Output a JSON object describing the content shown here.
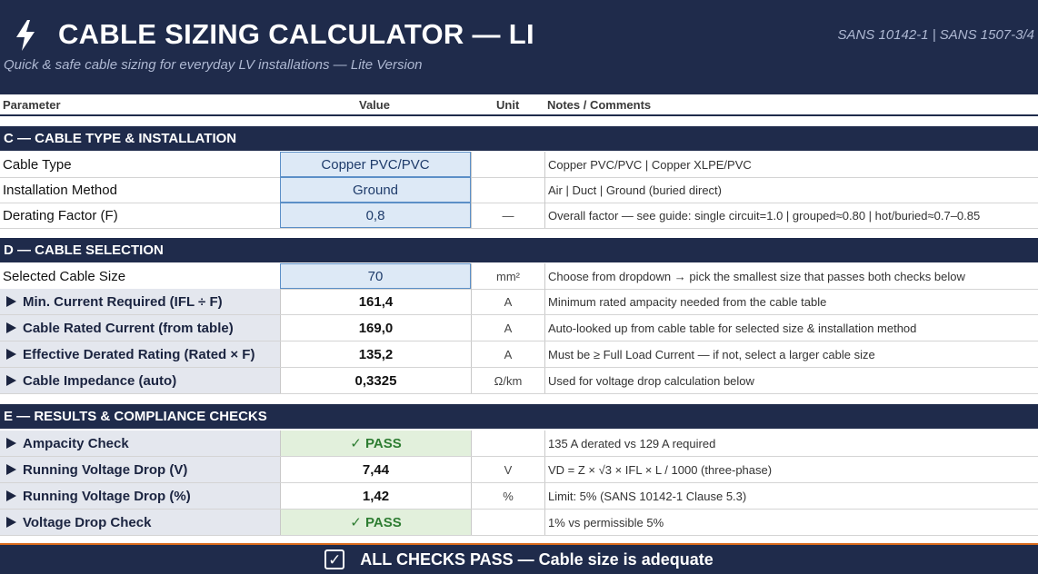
{
  "header": {
    "title": "CABLE SIZING CALCULATOR  —  LI",
    "subtitle": "Quick & safe cable sizing for everyday LV installations  —  Lite Version",
    "standards": "SANS 10142-1  |  SANS 1507-3/4",
    "icon": "lightning-bolt-icon"
  },
  "columns": {
    "parameter": "Parameter",
    "value": "Value",
    "unit": "Unit",
    "notes": "Notes / Comments"
  },
  "sections": {
    "c": "C  —  CABLE TYPE & INSTALLATION",
    "d": "D  —  CABLE SELECTION",
    "e": "E  —  RESULTS & COMPLIANCE CHECKS"
  },
  "rows": {
    "cable_type": {
      "param": "Cable Type",
      "value": "Copper PVC/PVC",
      "unit": "",
      "notes": "Copper PVC/PVC  |  Copper XLPE/PVC"
    },
    "installation": {
      "param": "Installation Method",
      "value": "Ground",
      "unit": "",
      "notes": "Air  |  Duct  |  Ground (buried direct)"
    },
    "derating": {
      "param": "Derating Factor  (F)",
      "value": "0,8",
      "unit": "—",
      "notes": "Overall factor — see guide: single circuit=1.0 | grouped≈0.80 | hot/buried≈0.7–0.85"
    },
    "cable_size": {
      "param": "Selected Cable Size",
      "value": "70",
      "unit": "mm²",
      "notes": "Choose from dropdown → pick the smallest size that passes both checks below"
    },
    "min_current": {
      "param": "Min. Current Required  (IFL ÷ F)",
      "value": "161,4",
      "unit": "A",
      "notes": "Minimum rated ampacity needed from the cable table"
    },
    "rated_current": {
      "param": "Cable Rated Current  (from table)",
      "value": "169,0",
      "unit": "A",
      "notes": "Auto-looked up from cable table for selected size & installation method"
    },
    "effective_rating": {
      "param": "Effective Derated Rating  (Rated × F)",
      "value": "135,2",
      "unit": "A",
      "notes": "Must be ≥ Full Load Current — if not, select a larger cable size"
    },
    "impedance": {
      "param": "Cable Impedance  (auto)",
      "value": "0,3325",
      "unit": "Ω/km",
      "notes": "Used for voltage drop calculation below"
    },
    "ampacity_check": {
      "param": "Ampacity Check",
      "value": "✓  PASS",
      "unit": "",
      "notes": "135 A derated vs 129 A required"
    },
    "vd_volts": {
      "param": "Running Voltage Drop  (V)",
      "value": "7,44",
      "unit": "V",
      "notes": "VD = Z × √3 × IFL × L / 1000   (three-phase)"
    },
    "vd_percent": {
      "param": "Running Voltage Drop  (%)",
      "value": "1,42",
      "unit": "%",
      "notes": "Limit: 5%   (SANS 10142-1 Clause 5.3)"
    },
    "vd_check": {
      "param": "Voltage Drop Check",
      "value": "✓  PASS",
      "unit": "",
      "notes": "1% vs permissible 5%"
    }
  },
  "banner": {
    "text": "ALL CHECKS PASS — Cable size is adequate",
    "icon": "checkbox-checked-icon"
  },
  "colors": {
    "navy": "#1f2b4b",
    "input_fill": "#dde9f6",
    "pass_fill": "#e2f0dc",
    "pass_text": "#2e7d32",
    "accent_line": "#d96b1c"
  }
}
